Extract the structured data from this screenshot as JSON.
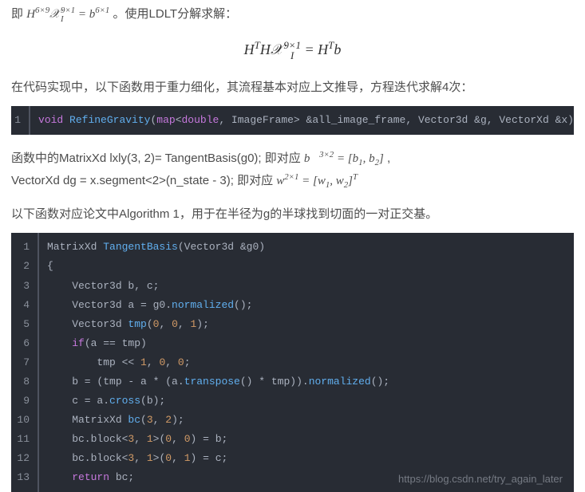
{
  "p1_prefix": "即",
  "p1_eq": "H<sup>6×9</sup>𝒳<span class=\"sup-sub\"><span>9×1</span><span>I</span></span> = b<sup>6×1</sup>",
  "p1_suffix": "。使用LDLT分解求解：",
  "math_block": "H<sup>T</sup>H𝒳<span class=\"sup-sub\"><span>9×1</span><span>I</span></span> = H<sup>T</sup>b",
  "p2": "在代码实现中，以下函数用于重力细化，其流程基本对应上文推导，方程迭代求解4次：",
  "code1": {
    "line": "<span class=\"c-kw\">void</span> <span class=\"c-fn\">RefineGravity</span>(<span class=\"c-type\">map</span>&lt;<span class=\"c-type\">double</span>, ImageFrame&gt; &amp;all_image_frame, Vector3d &amp;g, VectorXd &amp;x)"
  },
  "p3_a": "函数中的MatrixXd lxly(3, 2)= TangentBasis(g0); 即对应",
  "p3_a_eq": "b⃗<sup>3×2</sup> = [b<sub>1</sub>, b<sub>2</sub>]",
  "p3_a_suffix": " ,",
  "p3_b": "VectorXd dg = x.segment<2>(n_state - 3); 即对应",
  "p3_b_eq": "w<sup>2×1</sup> = [w<sub>1</sub>, w<sub>2</sub>]<sup>T</sup>",
  "p4": "以下函数对应论文中Algorithm 1，用于在半径为g的半球找到切面的一对正交基。",
  "code2": {
    "lines": [
      "MatrixXd <span class=\"c-fn\">TangentBasis</span>(Vector3d &amp;g0)",
      "{",
      "    Vector3d b, c;",
      "    Vector3d a = g0.<span class=\"c-call\">normalized</span>();",
      "    Vector3d <span class=\"c-call\">tmp</span>(<span class=\"c-num\">0</span>, <span class=\"c-num\">0</span>, <span class=\"c-num\">1</span>);",
      "    <span class=\"c-kw\">if</span>(a == tmp)",
      "        tmp &lt;&lt; <span class=\"c-num\">1</span>, <span class=\"c-num\">0</span>, <span class=\"c-num\">0</span>;",
      "    b = (tmp - a * (a.<span class=\"c-call\">transpose</span>() * tmp)).<span class=\"c-call\">normalized</span>();",
      "    c = a.<span class=\"c-call\">cross</span>(b);",
      "    MatrixXd <span class=\"c-call\">bc</span>(<span class=\"c-num\">3</span>, <span class=\"c-num\">2</span>);",
      "    bc.block&lt;<span class=\"c-num\">3</span>, <span class=\"c-num\">1</span>&gt;(<span class=\"c-num\">0</span>, <span class=\"c-num\">0</span>) = b;",
      "    bc.block&lt;<span class=\"c-num\">3</span>, <span class=\"c-num\">1</span>&gt;(<span class=\"c-num\">0</span>, <span class=\"c-num\">1</span>) = c;",
      "    <span class=\"c-kw\">return</span> bc;"
    ]
  },
  "watermark": "https://blog.csdn.net/try_again_later"
}
